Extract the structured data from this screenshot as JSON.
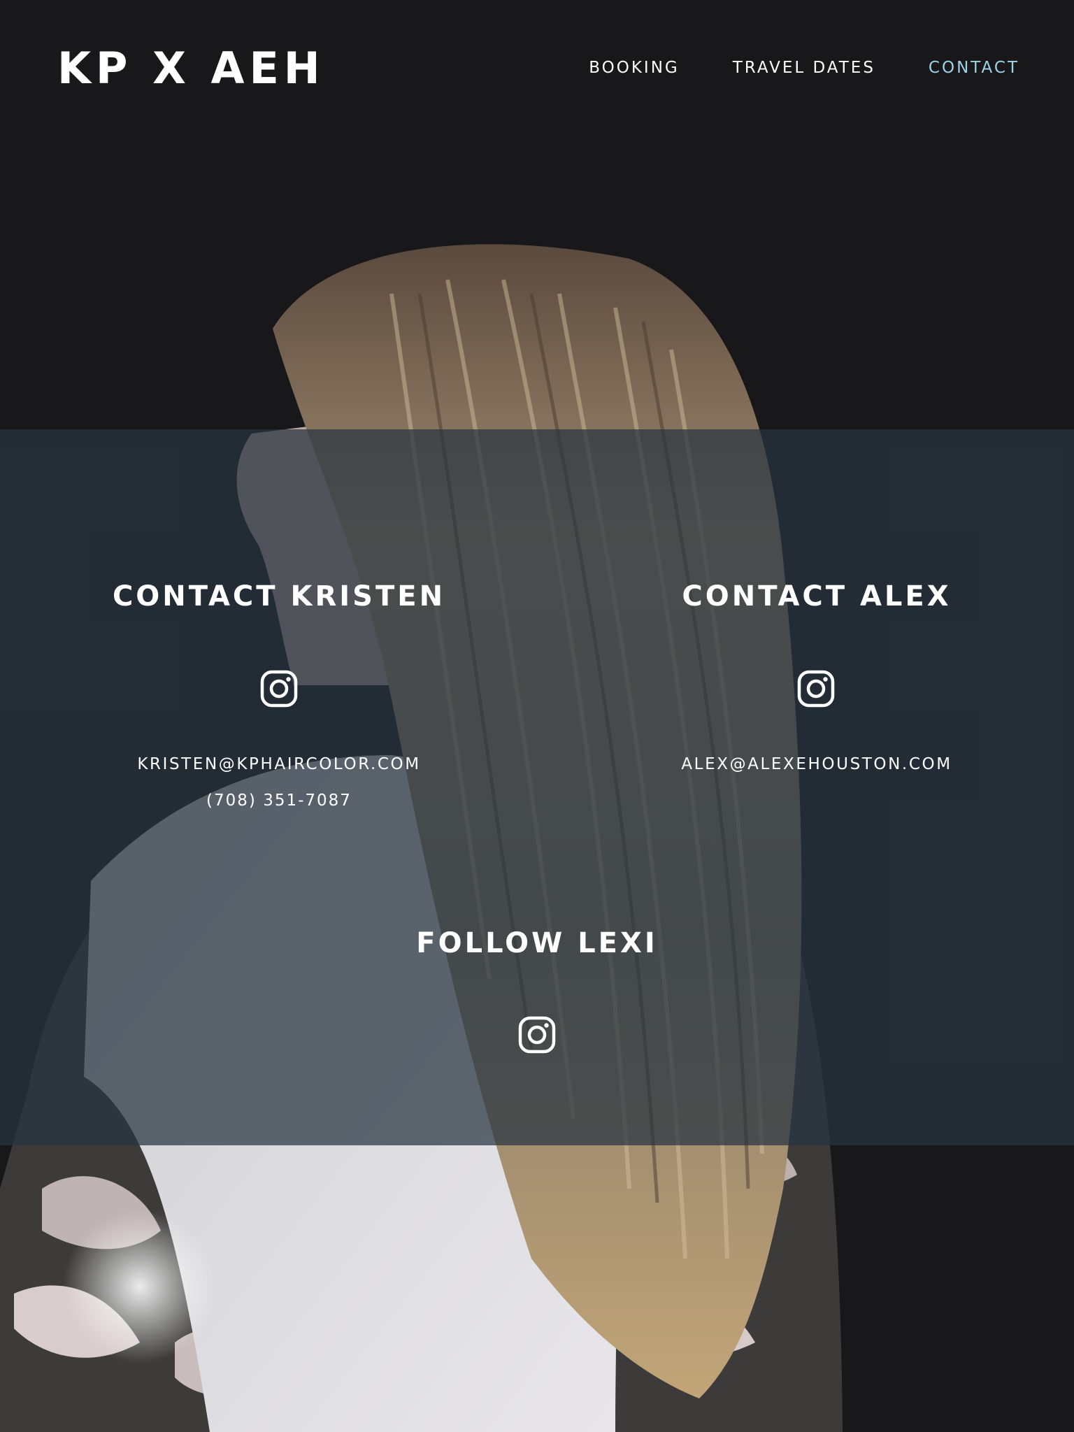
{
  "header": {
    "logo": "KP X AEH",
    "nav": [
      {
        "label": "BOOKING",
        "active": false
      },
      {
        "label": "TRAVEL DATES",
        "active": false
      },
      {
        "label": "CONTACT",
        "active": true
      }
    ]
  },
  "contact": {
    "kristen": {
      "heading": "CONTACT KRISTEN",
      "icon": "instagram-icon",
      "email": "KRISTEN@KPHAIRCOLOR.COM",
      "phone": "(708) 351-7087"
    },
    "alex": {
      "heading": "CONTACT ALEX",
      "icon": "instagram-icon",
      "email": "ALEX@ALEXEHOUSTON.COM"
    },
    "lexi": {
      "heading": "FOLLOW LEXI",
      "icon": "instagram-icon"
    }
  },
  "colors": {
    "background": "#18181b",
    "band": "#283440",
    "text": "#ffffff",
    "nav_active": "#9fd3e3"
  }
}
